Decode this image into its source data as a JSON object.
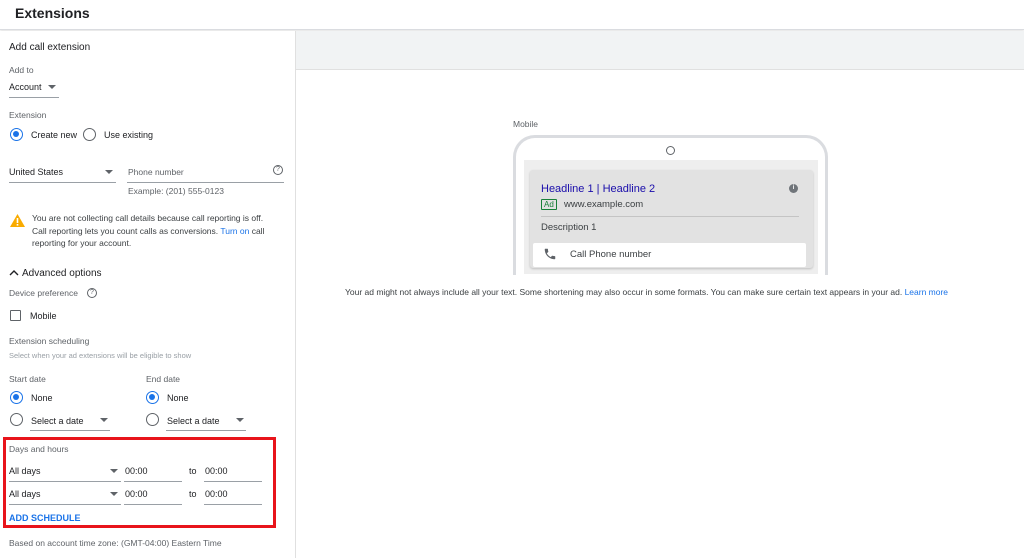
{
  "header": {
    "title": "Extensions"
  },
  "form": {
    "section_title": "Add call extension",
    "add_to": {
      "label": "Add to",
      "value": "Account"
    },
    "extension": {
      "label": "Extension",
      "create_new": "Create new",
      "use_existing": "Use existing",
      "selected": "Create new"
    },
    "country": {
      "value": "United States"
    },
    "phone": {
      "placeholder": "Phone number",
      "example": "Example: (201) 555-0123"
    },
    "warning": {
      "line1": "You are not collecting call details because call reporting is off.",
      "line2a": "Call reporting lets you count calls as conversions. ",
      "link": "Turn on",
      "line2b": " call",
      "line3": "reporting for your account."
    },
    "advanced": {
      "label": "Advanced options"
    },
    "device": {
      "label": "Device preference",
      "mobile": "Mobile",
      "checked": false
    },
    "scheduling": {
      "label": "Extension scheduling",
      "hint": "Select when your ad extensions will be eligible to show"
    },
    "start_date": {
      "label": "Start date",
      "none": "None",
      "select": "Select a date",
      "selected": "None"
    },
    "end_date": {
      "label": "End date",
      "none": "None",
      "select": "Select a date",
      "selected": "None"
    },
    "days_hours": {
      "label": "Days and hours",
      "rows": [
        {
          "day": "All days",
          "from": "00:00",
          "to_label": "to",
          "to": "00:00"
        },
        {
          "day": "All days",
          "from": "00:00",
          "to_label": "to",
          "to": "00:00"
        }
      ],
      "add_schedule": "ADD SCHEDULE"
    },
    "timezone_note": "Based on account time zone: (GMT-04:00) Eastern Time"
  },
  "preview": {
    "device_label": "Mobile",
    "headline": "Headline 1 | Headline 2",
    "ad_badge": "Ad",
    "url": "www.example.com",
    "description": "Description 1",
    "call_text": "Call Phone number",
    "note": "Your ad might not always include all your text. Some shortening may also occur in some formats. You can make sure certain text appears in your ad. ",
    "learn_more": "Learn more"
  },
  "colors": {
    "accent": "#1a73e8",
    "highlight_box": "#e8141b",
    "warning": "#f9ab00",
    "headline": "#1a0dab"
  }
}
